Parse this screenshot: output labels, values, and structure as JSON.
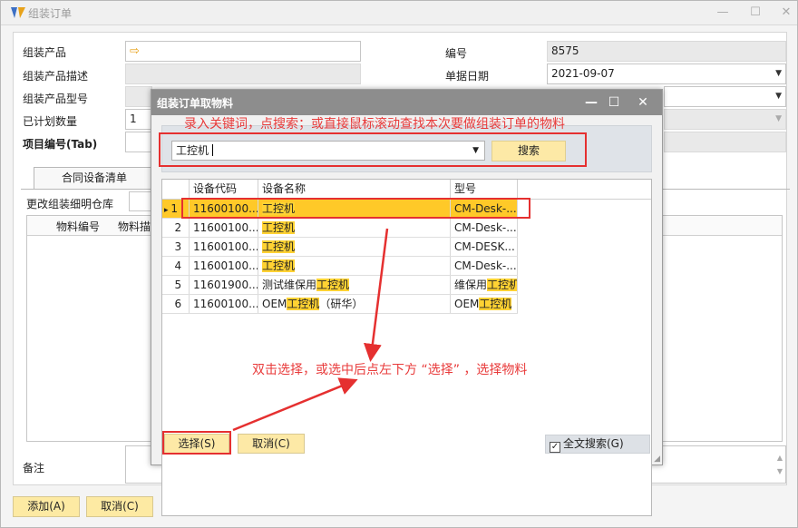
{
  "window": {
    "title": "组装订单"
  },
  "form": {
    "product_label": "组装产品",
    "desc_label": "组装产品描述",
    "model_label": "组装产品型号",
    "planned_qty_label": "已计划数量",
    "planned_qty_value": "1",
    "project_label": "项目编号(Tab)",
    "number_label": "编号",
    "number_value": "8575",
    "date_label": "单据日期",
    "date_value": "2021-09-07",
    "tab_label": "合同设备清单",
    "warehouse_label": "更改组装细明仓库",
    "grid_col1": "物料编号",
    "grid_col2": "物料描",
    "remark_label": "备注",
    "add_button": "添加(A)",
    "cancel_button": "取消(C)"
  },
  "dialog": {
    "title": "组装订单取物料",
    "search_value": "工控机",
    "search_button": "搜索",
    "columns": [
      "设备代码",
      "设备名称",
      "型号"
    ],
    "rows": [
      {
        "no": "1",
        "code": "11600100...",
        "name_pre": "",
        "name_hl": "工控机",
        "name_post": "",
        "model_pre": "CM-Desk-...",
        "model_hl": "",
        "model_post": ""
      },
      {
        "no": "2",
        "code": "11600100...",
        "name_pre": "",
        "name_hl": "工控机",
        "name_post": "",
        "model_pre": "CM-Desk-...",
        "model_hl": "",
        "model_post": ""
      },
      {
        "no": "3",
        "code": "11600100...",
        "name_pre": "",
        "name_hl": "工控机",
        "name_post": "",
        "model_pre": "CM-DESK...",
        "model_hl": "",
        "model_post": ""
      },
      {
        "no": "4",
        "code": "11600100...",
        "name_pre": "",
        "name_hl": "工控机",
        "name_post": "",
        "model_pre": "CM-Desk-...",
        "model_hl": "",
        "model_post": ""
      },
      {
        "no": "5",
        "code": "11601900...",
        "name_pre": "测试维保用",
        "name_hl": "工控机",
        "name_post": "",
        "model_pre": "维保用",
        "model_hl": "工控机",
        "model_post": ""
      },
      {
        "no": "6",
        "code": "11600100...",
        "name_pre": "OEM",
        "name_hl": "工控机",
        "name_post": "（研华）",
        "model_pre": "OEM",
        "model_hl": "工控机",
        "model_post": ""
      }
    ],
    "select_button": "选择(S)",
    "cancel_button": "取消(C)",
    "fulltext_label": "全文搜索(G)"
  },
  "annotations": {
    "top": "录入关键词，点搜索；或直接鼠标滚动查找本次要做组装订单的物料",
    "middle": "双击选择，或选中后点左下方 “选择” ，选择物料"
  },
  "colors": {
    "highlight": "#ffc928",
    "accent_button": "#fde9a6",
    "annotation": "#e53030"
  }
}
